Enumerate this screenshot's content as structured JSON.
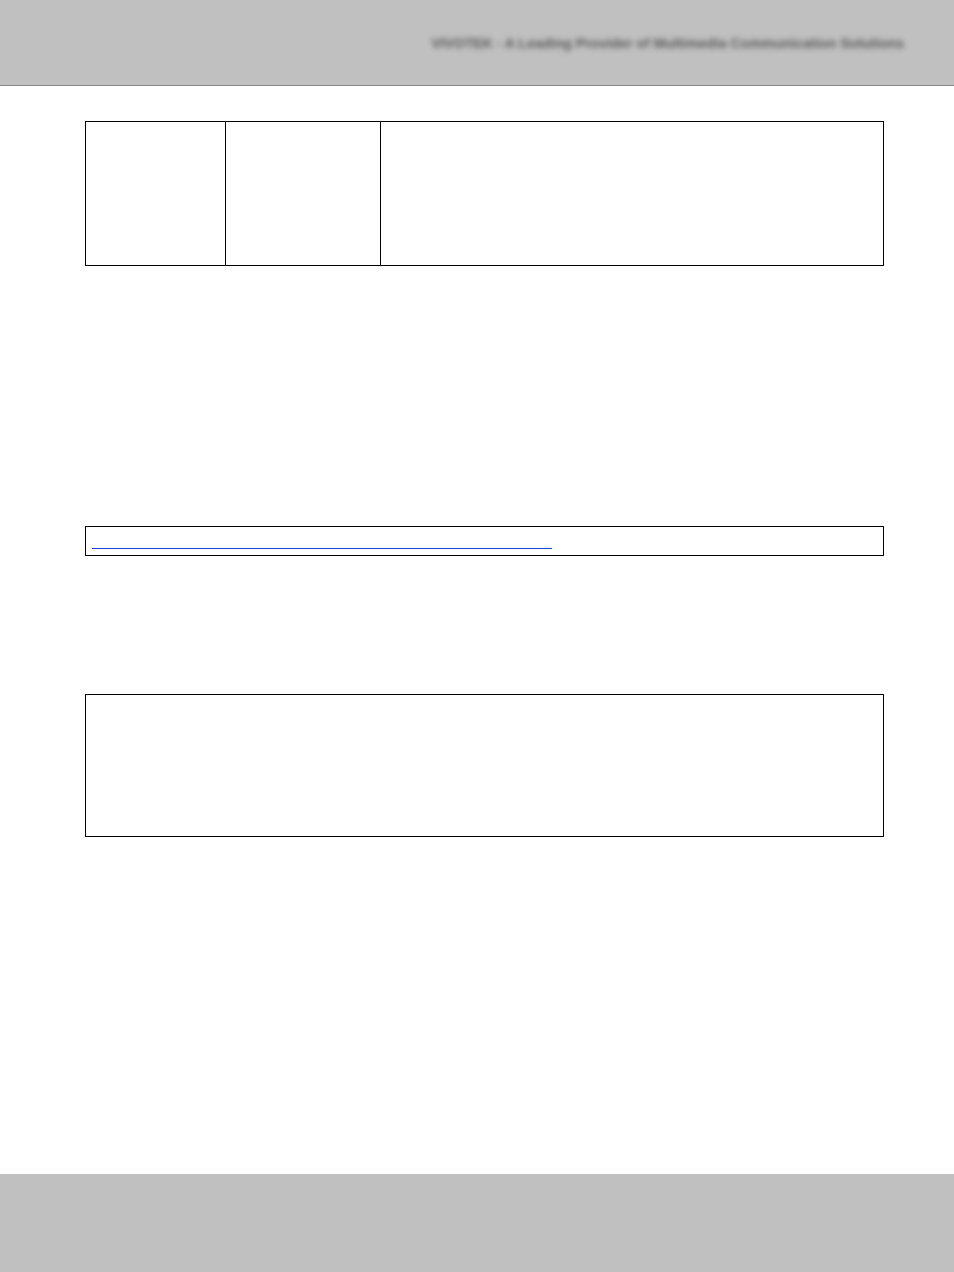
{
  "header": {
    "title": "VIVOTEK - A Leading Provider of Multimedia Communication Solutions"
  },
  "table1": {
    "row1": {
      "col1": "",
      "col2": "",
      "col3": ""
    }
  },
  "linkBox": {
    "content": ""
  },
  "bigBox": {
    "content": ""
  }
}
